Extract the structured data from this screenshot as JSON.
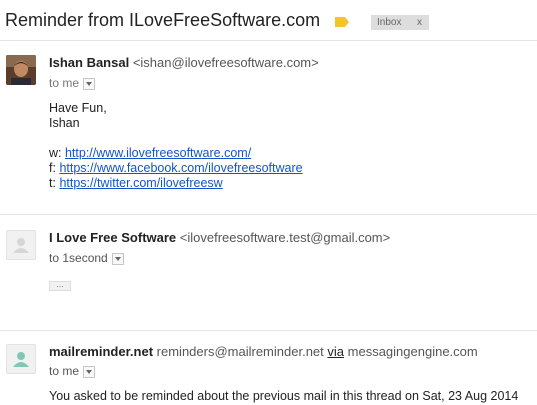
{
  "thread": {
    "subject": "Reminder from ILoveFreeSoftware.com",
    "label": "Inbox",
    "label_remove": "x"
  },
  "messages": [
    {
      "sender_name": "Ishan Bansal",
      "sender_email": "<ishan@ilovefreesoftware.com>",
      "to": "to me",
      "body_lines": [
        "Have Fun,",
        "Ishan"
      ],
      "links": [
        {
          "prefix": "w:",
          "url": "http://www.ilovefreesoftware.com/"
        },
        {
          "prefix": "f:",
          "url": "https://www.facebook.com/ilovefreesoftware"
        },
        {
          "prefix": "t:",
          "url": "https://twitter.com/ilovefreesw"
        }
      ]
    },
    {
      "sender_name": "I Love Free Software",
      "sender_email": "<ilovefreesoftware.test@gmail.com>",
      "to": "to 1second",
      "collapsed_indicator": "..."
    },
    {
      "sender_name": "mailreminder.net",
      "sender_email": "reminders@mailreminder.net",
      "via_label": "via",
      "via_domain": "messagingengine.com",
      "to": "to me",
      "snippet": "You asked to be reminded about the previous mail in this thread on Sat, 23 Aug 2014"
    }
  ],
  "colors": {
    "link": "#1155cc",
    "label_bg": "#dddddd",
    "tag": "#f4c430",
    "avatar_teal": "#7fc8b5"
  }
}
